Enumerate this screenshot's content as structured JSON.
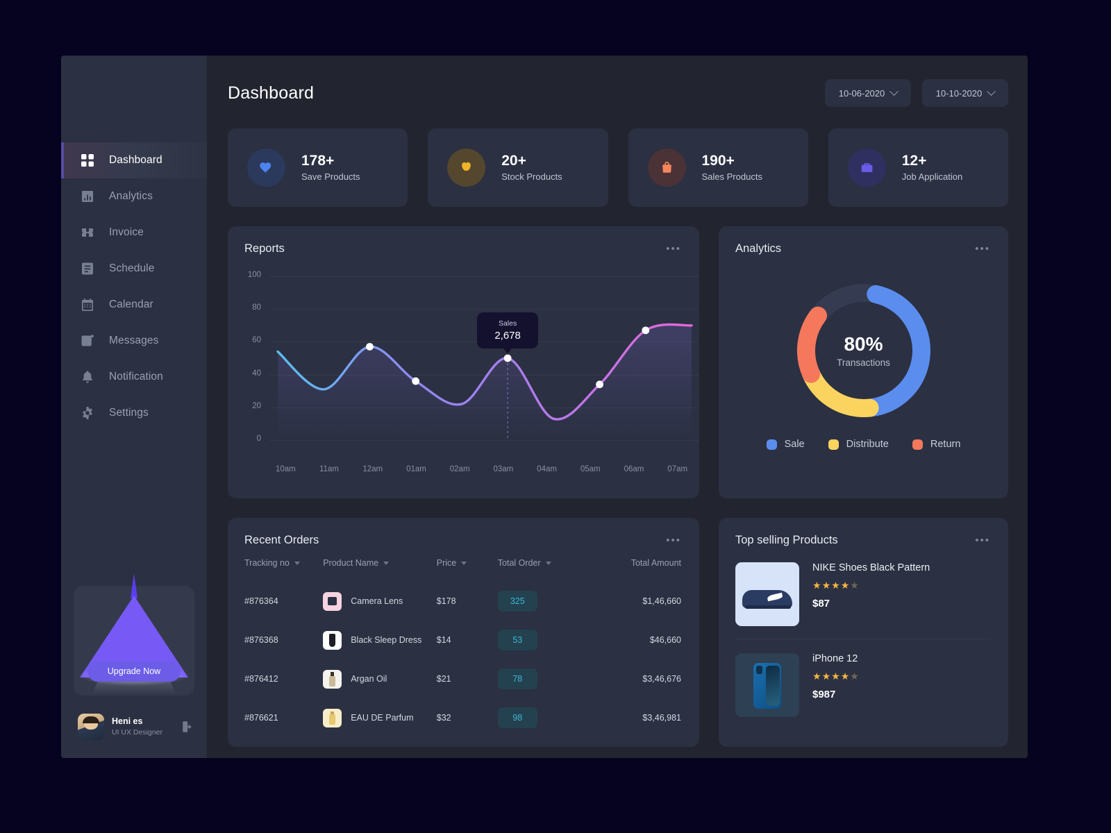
{
  "sidebar": {
    "items": [
      {
        "label": "Dashboard",
        "icon": "grid-icon",
        "active": true
      },
      {
        "label": "Analytics",
        "icon": "bar-chart-icon",
        "active": false
      },
      {
        "label": "Invoice",
        "icon": "invoice-icon",
        "active": false
      },
      {
        "label": "Schedule",
        "icon": "schedule-icon",
        "active": false
      },
      {
        "label": "Calendar",
        "icon": "calendar-icon",
        "active": false
      },
      {
        "label": "Messages",
        "icon": "messages-icon",
        "active": false
      },
      {
        "label": "Notification",
        "icon": "bell-icon",
        "active": false
      },
      {
        "label": "Settings",
        "icon": "gear-icon",
        "active": false
      }
    ],
    "upgrade": {
      "button_label": "Upgrade Now"
    },
    "profile": {
      "name": "Heni es",
      "role": "UI UX Designer"
    }
  },
  "header": {
    "title": "Dashboard",
    "date_from": "10-06-2020",
    "date_to": "10-10-2020"
  },
  "stats": [
    {
      "value": "178+",
      "label": "Save Products",
      "icon": "heart-icon",
      "icon_color": "#4b84f0",
      "bg": "#2b3a5c"
    },
    {
      "value": "20+",
      "label": "Stock Products",
      "icon": "apple-icon",
      "icon_color": "#f0b429",
      "bg": "#54472e"
    },
    {
      "value": "190+",
      "label": "Sales Products",
      "icon": "shopping-bag-icon",
      "icon_color": "#f5865c",
      "bg": "#4a3236"
    },
    {
      "value": "12+",
      "label": "Job Application",
      "icon": "briefcase-icon",
      "icon_color": "#6c5ce7",
      "bg": "#2f3060"
    }
  ],
  "reports": {
    "title": "Reports",
    "menu": "•••",
    "tooltip": {
      "label": "Sales",
      "value": "2,678"
    }
  },
  "analytics": {
    "title": "Analytics",
    "menu": "•••",
    "center_value": "80%",
    "center_label": "Transactions",
    "legend": [
      {
        "label": "Sale",
        "color": "#5b8def"
      },
      {
        "label": "Distribute",
        "color": "#fbd45f"
      },
      {
        "label": "Return",
        "color": "#f5785c"
      }
    ]
  },
  "orders": {
    "title": "Recent Orders",
    "menu": "•••",
    "columns": [
      "Tracking no",
      "Product Name",
      "Price",
      "Total Order",
      "Total Amount"
    ],
    "rows": [
      {
        "tracking": "#876364",
        "product": "Camera Lens",
        "price": "$178",
        "total_order": "325",
        "amount": "$1,46,660",
        "thumb": "camera-thumb"
      },
      {
        "tracking": "#876368",
        "product": "Black Sleep Dress",
        "price": "$14",
        "total_order": "53",
        "amount": "$46,660",
        "thumb": "dress-thumb"
      },
      {
        "tracking": "#876412",
        "product": "Argan Oil",
        "price": "$21",
        "total_order": "78",
        "amount": "$3,46,676",
        "thumb": "oil-thumb"
      },
      {
        "tracking": "#876621",
        "product": "EAU DE Parfum",
        "price": "$32",
        "total_order": "98",
        "amount": "$3,46,981",
        "thumb": "perfume-thumb"
      }
    ]
  },
  "top_selling": {
    "title": "Top selling Products",
    "menu": "•••",
    "products": [
      {
        "name": "NIKE Shoes Black Pattern",
        "rating": 4,
        "max_rating": 5,
        "price": "$87",
        "thumb": "shoe-thumb"
      },
      {
        "name": "iPhone 12",
        "rating": 4,
        "max_rating": 5,
        "price": "$987",
        "thumb": "iphone-thumb"
      }
    ]
  },
  "chart_data": {
    "type": "line",
    "title": "Reports",
    "x": [
      "10am",
      "11am",
      "12am",
      "01am",
      "02am",
      "03am",
      "04am",
      "05am",
      "06am",
      "07am"
    ],
    "values": [
      54,
      31,
      57,
      36,
      22,
      50,
      13,
      34,
      67,
      70
    ],
    "markers": [
      {
        "x": "12am",
        "y": 57
      },
      {
        "x": "01am",
        "y": 36
      },
      {
        "x": "03am",
        "y": 50
      },
      {
        "x": "05am",
        "y": 34
      },
      {
        "x": "06am",
        "y": 67
      }
    ],
    "highlight": {
      "x": "03am",
      "y": 50,
      "label": "Sales",
      "value": "2,678"
    },
    "ylim": [
      0,
      100
    ],
    "yticks": [
      0,
      20,
      40,
      60,
      80,
      100
    ],
    "xlabel": "",
    "ylabel": "",
    "grid": true,
    "legend": "none",
    "line_gradient": [
      "#5bc0f0",
      "#9b7bf0",
      "#e866d8"
    ]
  },
  "donut_data": {
    "type": "pie",
    "title": "Analytics",
    "labels": [
      "Sale",
      "Distribute",
      "Return"
    ],
    "values": [
      45,
      20,
      17
    ],
    "colors": [
      "#5b8def",
      "#fbd45f",
      "#f5785c"
    ],
    "track_color": "#353b50",
    "center_value": "80%",
    "center_label": "Transactions"
  }
}
